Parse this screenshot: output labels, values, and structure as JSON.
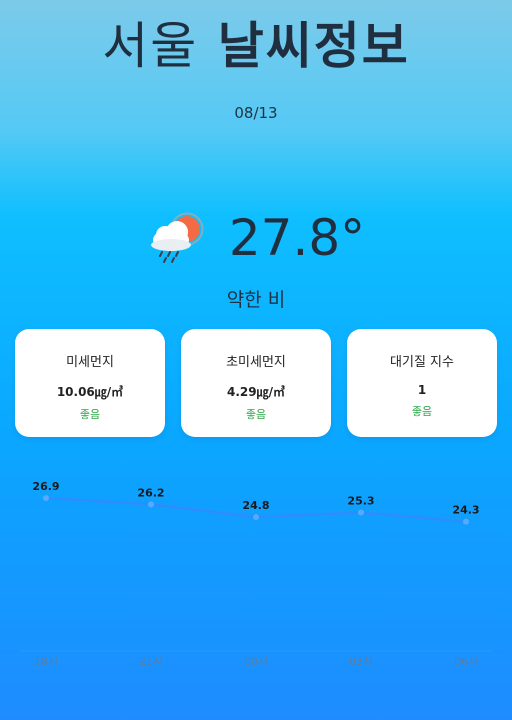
{
  "header": {
    "city": "서울",
    "title": "날씨정보",
    "date": "08/13"
  },
  "current": {
    "icon": "cloud-sun-rain-icon",
    "temperature": "27.8°",
    "condition": "약한 비"
  },
  "air_quality": [
    {
      "label": "미세먼지",
      "value": "10.06㎍/㎥",
      "status": "좋음"
    },
    {
      "label": "초미세먼지",
      "value": "4.29㎍/㎥",
      "status": "좋음"
    },
    {
      "label": "대기질 지수",
      "value": "1",
      "status": "좋음"
    }
  ],
  "colors": {
    "good": "#2ea84a",
    "line": "#2f8cff",
    "axis": "#5a7ea3"
  },
  "chart_data": {
    "type": "line",
    "categories": [
      "18시",
      "21시",
      "00시",
      "03시",
      "06시"
    ],
    "series": [
      {
        "values": [
          26.9,
          26.2,
          24.8,
          25.3,
          24.3
        ]
      }
    ],
    "ylim": [
      10,
      30
    ],
    "grid": false
  }
}
